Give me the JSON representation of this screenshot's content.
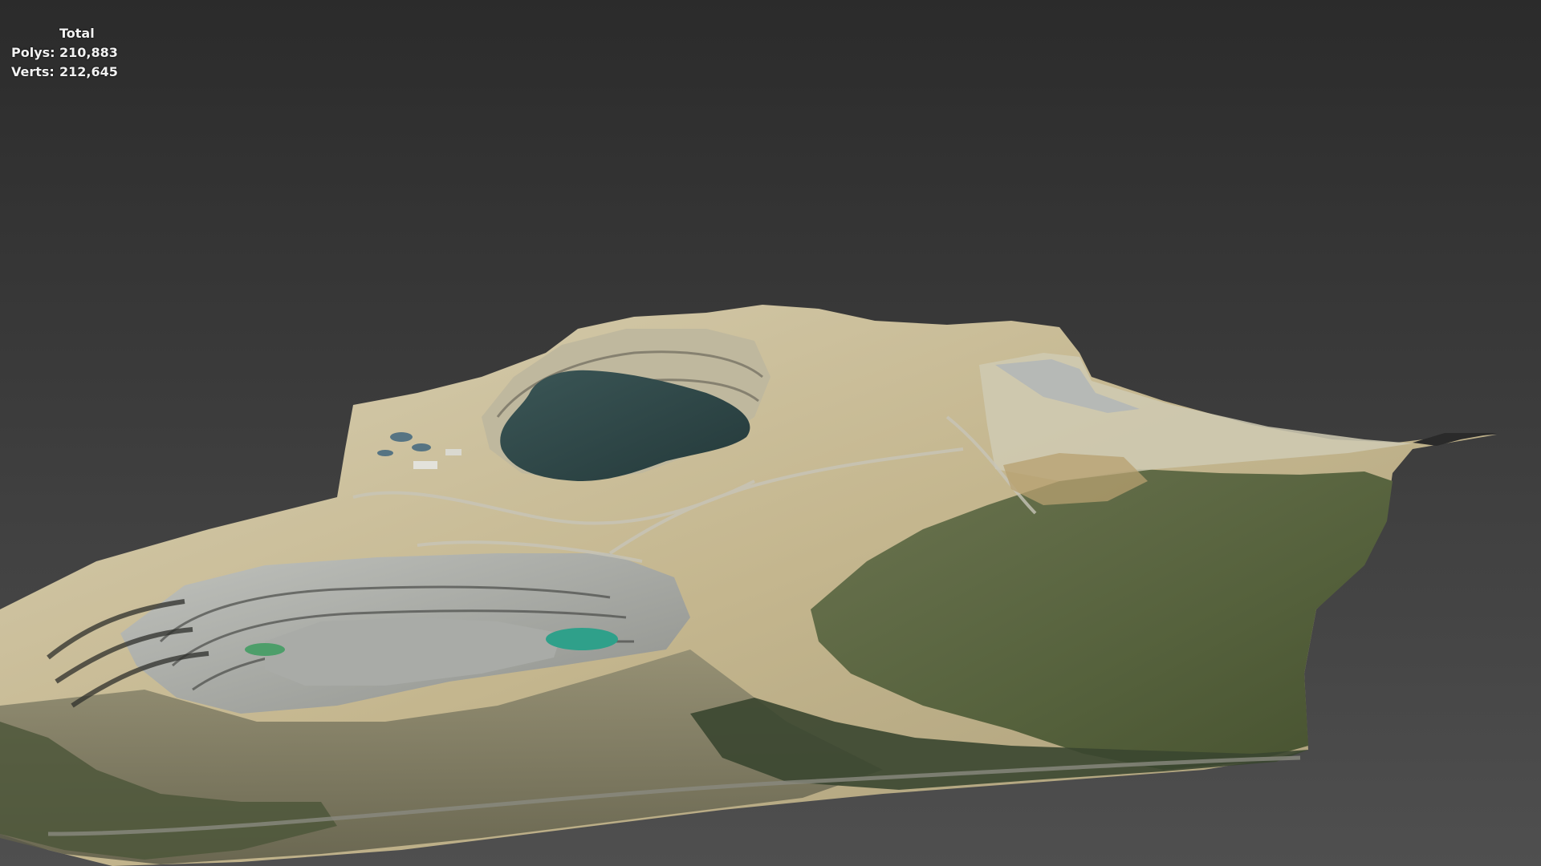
{
  "stats": {
    "title": "Total",
    "polys_label": "Polys:",
    "polys_value": "210,883",
    "verts_label": "Verts:",
    "verts_value": "212,645"
  },
  "scene": {
    "background_colors": [
      "#2b2b2b",
      "#4f4f4f"
    ],
    "terrain_colors": {
      "sand": "#c9bb93",
      "light": "#d9d2b8",
      "rock": "#9a9a95",
      "dark": "#4a4c44",
      "vegetation": "#5a6b3f",
      "forest": "#3e4a30",
      "water": "#2f4a4a",
      "teal": "#3aa08a"
    }
  }
}
